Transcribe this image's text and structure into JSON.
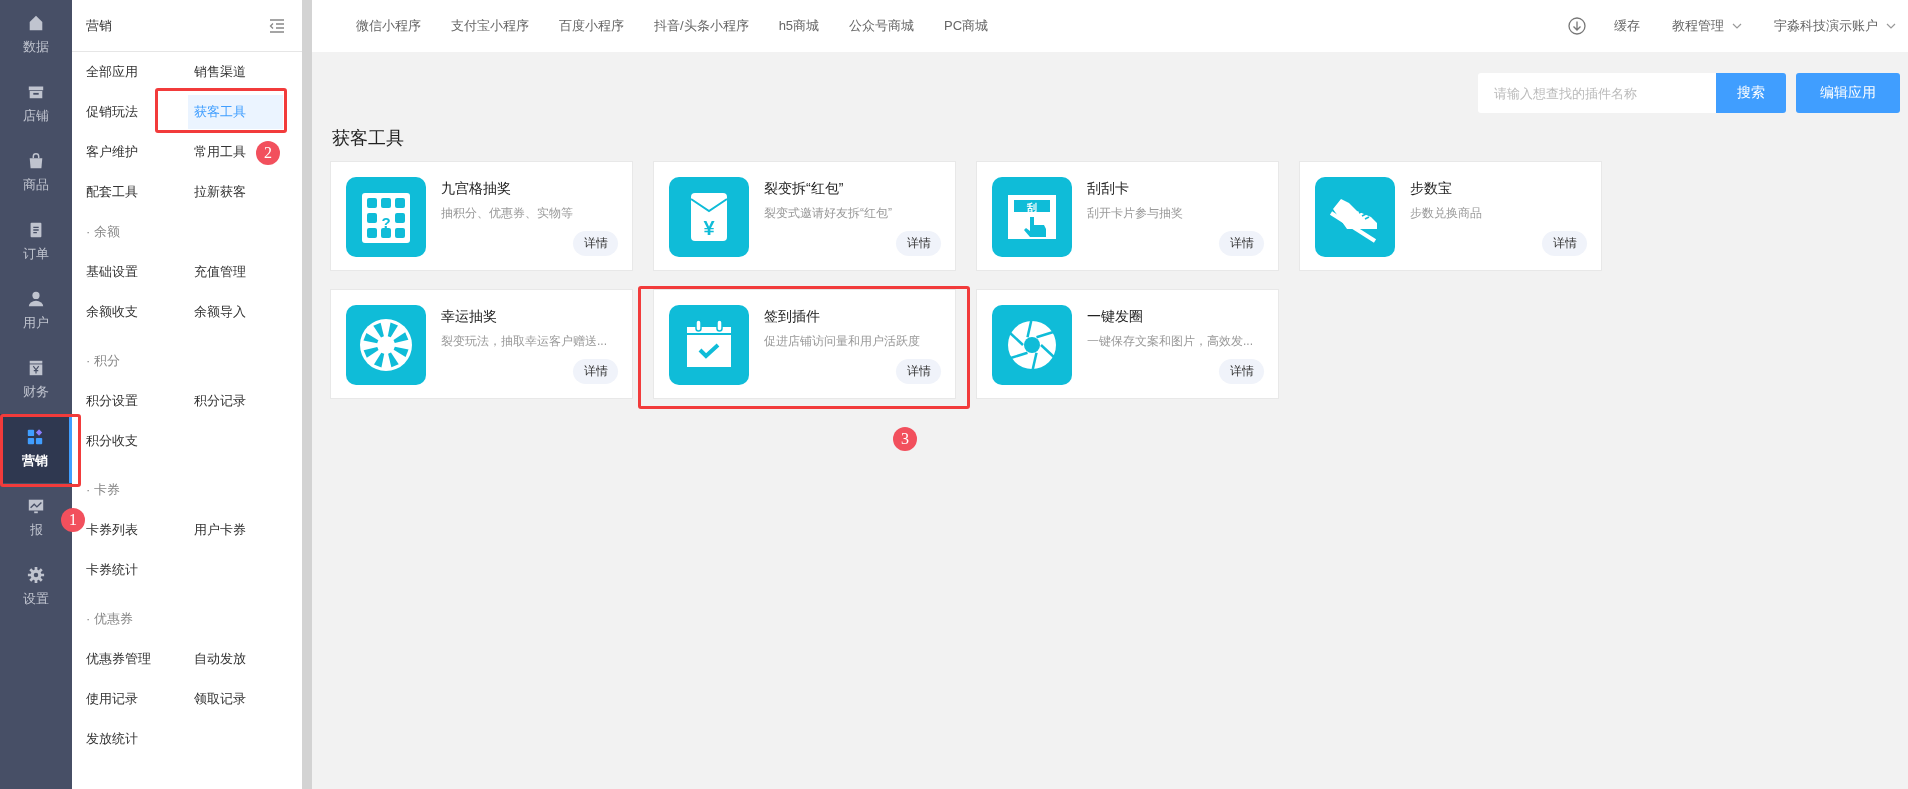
{
  "rail": [
    {
      "label": "数据",
      "kind": "home",
      "selected": false
    },
    {
      "label": "店铺",
      "kind": "store",
      "selected": false
    },
    {
      "label": "商品",
      "kind": "bag",
      "selected": false
    },
    {
      "label": "订单",
      "kind": "order",
      "selected": false
    },
    {
      "label": "用户",
      "kind": "user",
      "selected": false
    },
    {
      "label": "财务",
      "kind": "finance",
      "selected": false
    },
    {
      "label": "营销",
      "kind": "apps",
      "selected": true,
      "highlighted": true,
      "callout": "1"
    },
    {
      "label": "报",
      "kind": "chart",
      "selected": false
    },
    {
      "label": "设置",
      "kind": "gear",
      "selected": false
    }
  ],
  "subnav": {
    "title": "营销",
    "groups": [
      {
        "rows": [
          {
            "items": [
              {
                "label": "全部应用",
                "selected": false
              },
              {
                "label": "销售渠道",
                "selected": false
              }
            ]
          },
          {
            "items": [
              {
                "label": "促销玩法",
                "selected": false
              },
              {
                "label": "获客工具",
                "selected": true,
                "highlighted": true,
                "callout": "2"
              }
            ]
          },
          {
            "items": [
              {
                "label": "客户维护",
                "selected": false
              },
              {
                "label": "常用工具",
                "selected": false
              }
            ]
          },
          {
            "items": [
              {
                "label": "配套工具",
                "selected": false
              },
              {
                "label": "拉新获客",
                "selected": false
              }
            ]
          }
        ]
      },
      {
        "heading": "· 余额",
        "rows": [
          {
            "items": [
              {
                "label": "基础设置",
                "selected": false
              },
              {
                "label": "充值管理",
                "selected": false
              }
            ]
          },
          {
            "items": [
              {
                "label": "余额收支",
                "selected": false
              },
              {
                "label": "余额导入",
                "selected": false
              }
            ]
          }
        ]
      },
      {
        "heading": "· 积分",
        "rows": [
          {
            "items": [
              {
                "label": "积分设置",
                "selected": false
              },
              {
                "label": "积分记录",
                "selected": false
              }
            ]
          },
          {
            "items": [
              {
                "label": "积分收支",
                "selected": false
              }
            ]
          }
        ]
      },
      {
        "heading": "· 卡券",
        "rows": [
          {
            "items": [
              {
                "label": "卡券列表",
                "selected": false
              },
              {
                "label": "用户卡券",
                "selected": false
              }
            ]
          },
          {
            "items": [
              {
                "label": "卡券统计",
                "selected": false
              }
            ]
          }
        ]
      },
      {
        "heading": "· 优惠券",
        "rows": [
          {
            "items": [
              {
                "label": "优惠券管理",
                "selected": false
              },
              {
                "label": "自动发放",
                "selected": false
              }
            ]
          },
          {
            "items": [
              {
                "label": "使用记录",
                "selected": false
              },
              {
                "label": "领取记录",
                "selected": false
              }
            ]
          },
          {
            "items": [
              {
                "label": "发放统计",
                "selected": false
              }
            ]
          }
        ]
      }
    ]
  },
  "topbar": {
    "tabs": [
      "微信小程序",
      "支付宝小程序",
      "百度小程序",
      "抖音/头条小程序",
      "h5商城",
      "公众号商城",
      "PC商城"
    ],
    "cache": "缓存",
    "tutorial": "教程管理",
    "account": "宇淼科技演示账户"
  },
  "search": {
    "placeholder": "请输入想查找的插件名称",
    "button": "搜索",
    "edit_button": "编辑应用"
  },
  "section_title": "获客工具",
  "cards": [
    {
      "title": "九宫格抽奖",
      "desc": "抽积分、优惠券、实物等",
      "kind": "grid",
      "icon_label": "?",
      "button": "详情"
    },
    {
      "title": "裂变拆“红包”",
      "desc": "裂变式邀请好友拆“红包”",
      "kind": "envelope",
      "icon_label": "¥",
      "button": "详情"
    },
    {
      "title": "刮刮卡",
      "desc": "刮开卡片参与抽奖",
      "kind": "scratch",
      "icon_label": "刮",
      "button": "详情"
    },
    {
      "title": "步数宝",
      "desc": "步数兑换商品",
      "kind": "shoe",
      "button": "详情"
    },
    {
      "title": "幸运抽奖",
      "desc": "裂变玩法，抽取幸运客户赠送...",
      "kind": "wheel",
      "button": "详情"
    },
    {
      "title": "签到插件",
      "desc": "促进店铺访问量和用户活跃度",
      "kind": "calendar",
      "button": "详情",
      "highlighted": true,
      "callout": "3"
    },
    {
      "title": "一键发圈",
      "desc": "一键保存文案和图片，高效发...",
      "kind": "aperture",
      "button": "详情"
    }
  ]
}
